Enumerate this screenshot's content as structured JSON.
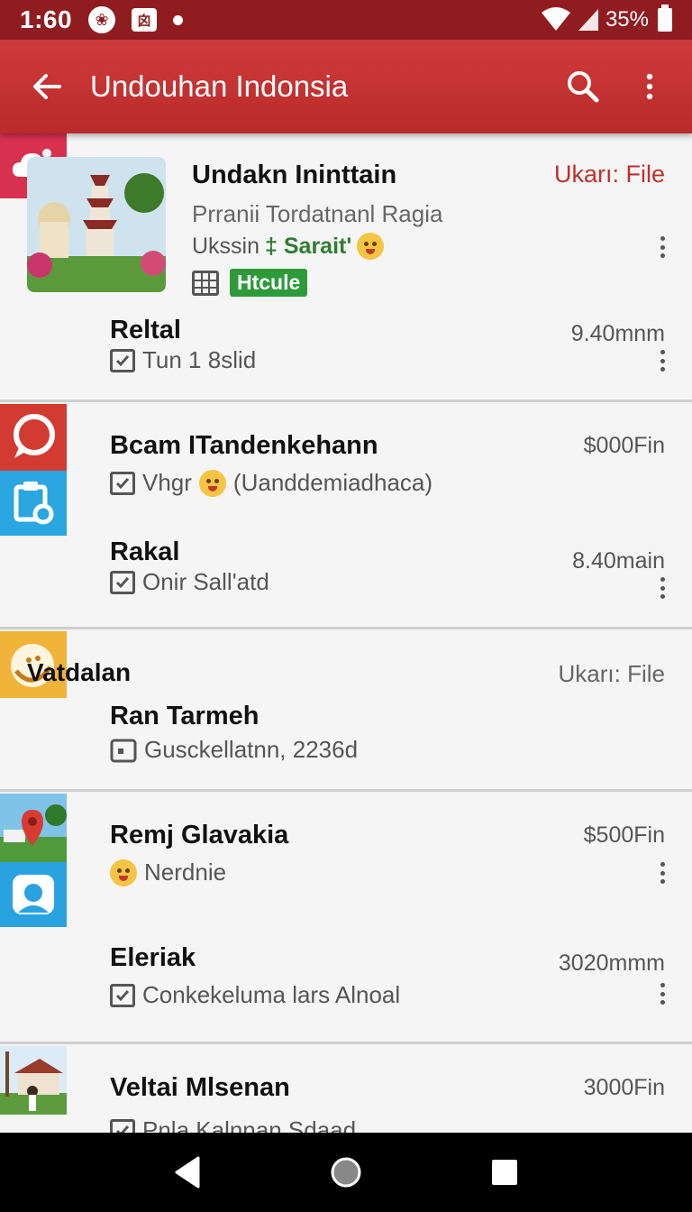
{
  "status_bar": {
    "time": "1:60",
    "icon1": "❀",
    "icon2": "囟",
    "battery": "35%"
  },
  "app_bar": {
    "title": "Undouhan Indonsia"
  },
  "featured": {
    "title": "Undakn Ininttain",
    "action_label": "Ukarı: File",
    "subtitle": "Prranii Tordatnanl Ragia",
    "tag_prefix": "Ukssin",
    "tag_green": "‡ Sarait'",
    "badge": "Htcule"
  },
  "rows": [
    {
      "name": "Reltal",
      "sub": "Tun 1 8slid",
      "meta": "9.40mnm"
    },
    {
      "name": "Bcam ITandenkehann",
      "sub": "Vhgr",
      "sub_after": "(Uanddemiadhaca)",
      "meta": "$000Fin"
    },
    {
      "name": "Rakal",
      "sub": "Onir Sall'atd",
      "meta": "8.40main"
    },
    {
      "section": "Vatdalan",
      "section_meta": "Ukarı: File",
      "name": "Ran Tarmeh",
      "sub": "Gusckellatnn, 2236d"
    },
    {
      "name": "Remj Glavakia",
      "sub": "Nerdnie",
      "meta": "$500Fin"
    },
    {
      "name": "Eleriak",
      "sub": "Conkekeluma lars Alnoal",
      "meta": "3020mmm"
    },
    {
      "name": "Veltai Mlsenan",
      "sub": "Pnla Kalnnan Sdaad",
      "meta": "3000Fin"
    }
  ],
  "colors": {
    "status_bar": "#8f1d20",
    "app_bar": "#c33434",
    "accent_red": "#c0302c",
    "badge_green": "#2e9a3a"
  }
}
